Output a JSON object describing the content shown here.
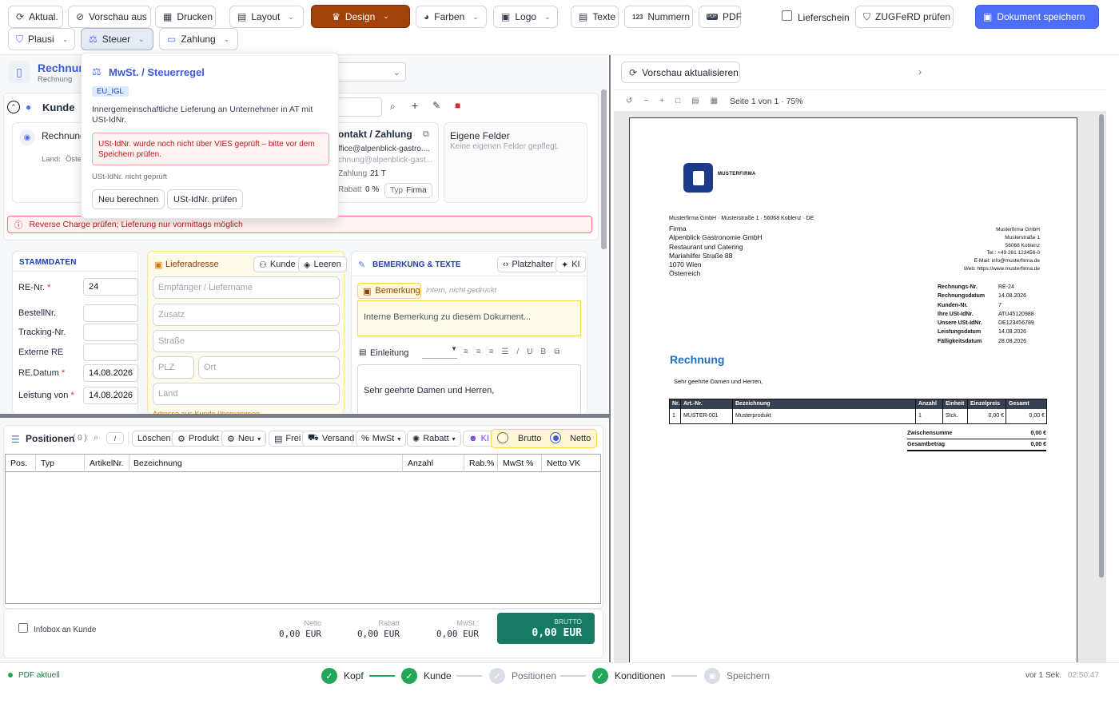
{
  "toolbar": {
    "refresh": "Aktual.",
    "preview_off": "Vorschau aus",
    "print": "Drucken",
    "layout": "Layout",
    "design": "Design",
    "colors": "Farben",
    "logo": "Logo",
    "texts": "Texte",
    "numbers": "Nummern",
    "numbers_icon_text": "123",
    "pdf": "PDF",
    "pdf_icon_text": "PDF",
    "delivery_note": "Lieferschein",
    "zugferd": "ZUGFeRD prüfen",
    "save": "Dokument speichern",
    "plausi": "Plausi",
    "tax": "Steuer",
    "payment": "Zahlung"
  },
  "doc_header": {
    "title": "Rechnun",
    "subtitle": "Rechnung"
  },
  "customer": {
    "section_title": "Kunde",
    "card_title": "Rechnung",
    "country_label": "Land:",
    "country_value": "Öste",
    "contact_title": "ontakt / Zahlung",
    "email1": "ffice@alpenblick-gastro....",
    "email2": "chnung@alpenblick-gast...",
    "payment_label": "Zahlung",
    "payment_value": "21 T",
    "discount_label": "Rabatt",
    "discount_value": "0 %",
    "type_label": "Typ",
    "type_value": "Firma",
    "own_fields_title": "Eigene Felder",
    "own_fields_text": "Keine eigenen Felder gepflegt.",
    "warning": "Reverse Charge prüfen; Lieferung nur vormittags möglich"
  },
  "popover": {
    "title": "MwSt. / Steuerregel",
    "badge": "EU_IGL",
    "description": "Innergemeinschaftliche Lieferung an Unternehmer in AT mit USt-IdNr.",
    "alert": "USt-IdNr. wurde noch nicht über VIES geprüft – bitte vor dem Speichern prüfen.",
    "status": "USt-IdNr. nicht geprüft",
    "recalc": "Neu berechnen",
    "check_vat": "USt-IdNr. prüfen"
  },
  "master": {
    "title": "STAMMDATEN",
    "invoice_no_label": "RE-Nr.",
    "invoice_no_value": "24",
    "order_no_label": "BestellNr.",
    "tracking_label": "Tracking-Nr.",
    "external_label": "Externe RE",
    "date_label": "RE.Datum",
    "date_value": "14.08.2026",
    "service_label": "Leistung von",
    "service_value": "14.08.2026",
    "required": "*"
  },
  "delivery": {
    "title": "Lieferadresse",
    "customer_btn": "Kunde",
    "clear_btn": "Leeren",
    "recipient_ph": "Empfänger / Liefername",
    "addition_ph": "Zusatz",
    "street_ph": "Straße",
    "zip_ph": "PLZ",
    "city_ph": "Ort",
    "country_ph": "Land",
    "hint": "Adresse aus Kunde übernommen"
  },
  "remarks": {
    "title": "BEMERKUNG & TEXTE",
    "placeholder_btn": "Platzhalter",
    "ai_btn": "KI",
    "note_label": "Bemerkung",
    "note_hint": "intern, nicht gedruckt",
    "note_ph": "Interne Bemerkung zu diesem Dokument...",
    "intro_label": "Einleitung",
    "intro_text": "Sehr geehrte Damen und Herren,"
  },
  "positions": {
    "title": "Positionen",
    "count": "( 0 )",
    "filter": "/",
    "delete": "Löschen",
    "product": "Produkt",
    "new": "Neu",
    "free": "Frei",
    "shipping": "Versand",
    "vat": "MwSt",
    "discount": "Rabatt",
    "ai": "KI",
    "gross": "Brutto",
    "net": "Netto",
    "columns": [
      "Pos.",
      "Typ",
      "ArtikelNr.",
      "Bezeichnung",
      "Anzahl",
      "Rab.%",
      "MwSt %",
      "Netto VK"
    ]
  },
  "totals": {
    "infobox": "Infobox an Kunde",
    "net_label": "Netto",
    "net_value": "0,00 EUR",
    "discount_label": "Rabatt",
    "discount_value": "0,00 EUR",
    "vat_label": "MwSt.:",
    "vat_value": "0,00 EUR",
    "gross_label": "BRUTTO",
    "gross_value": "0,00 EUR"
  },
  "preview": {
    "refresh": "Vorschau aktualisieren",
    "page_info": "Seite 1 von 1 · 75%",
    "company_logo": "MUSTERFIRMA",
    "sender_line": "Musterfirma GmbH · Musterstraße 1 · 56068 Koblenz · DE",
    "recipient": [
      "Firma",
      "Alpenblick Gastronomie GmbH",
      "Restaurant und Catering",
      "Mariahilfer Straße 88",
      "1070 Wien",
      "Österreich"
    ],
    "company_block": [
      "Musterfirma GmbH",
      "Musterstraße 1",
      "56068 Koblenz",
      "Tel.: +49 261 123456-0",
      "E-Mail: info@musterfirma.de",
      "Web: https://www.musterfirma.de"
    ],
    "meta": [
      {
        "label": "Rechnungs-Nr.",
        "value": "RE-24"
      },
      {
        "label": "Rechnungsdatum",
        "value": "14.08.2026"
      },
      {
        "label": "Kunden-Nr.",
        "value": "7"
      },
      {
        "label": "Ihre USt-IdNr.",
        "value": "ATU45120988"
      },
      {
        "label": "Unsere USt-IdNr.",
        "value": "DE123456789"
      },
      {
        "label": "Leistungsdatum",
        "value": "14.08.2026"
      },
      {
        "label": "Fälligkeitsdatum",
        "value": "28.08.2026"
      }
    ],
    "doc_title": "Rechnung",
    "greeting": "Sehr geehrte Damen und Herren,",
    "table_headers": [
      "Nr.",
      "Art.-Nr.",
      "Bezeichnung",
      "Anzahl",
      "Einheit",
      "Einzelpreis",
      "Gesamt"
    ],
    "table_row": [
      "1",
      "MUSTER-001",
      "Musterprodukt",
      "1",
      "Stck.",
      "0,00 €",
      "0,00 €"
    ],
    "subtotal_label": "Zwischensumme",
    "subtotal_value": "0,00 €",
    "total_label": "Gesamtbetrag",
    "total_value": "0,00 €"
  },
  "status": {
    "pdf_state": "PDF aktuell",
    "steps": [
      "Kopf",
      "Kunde",
      "Positionen",
      "Konditionen",
      "Speichern"
    ],
    "ago": "vor 1 Sek.",
    "time": "02:50:47"
  }
}
